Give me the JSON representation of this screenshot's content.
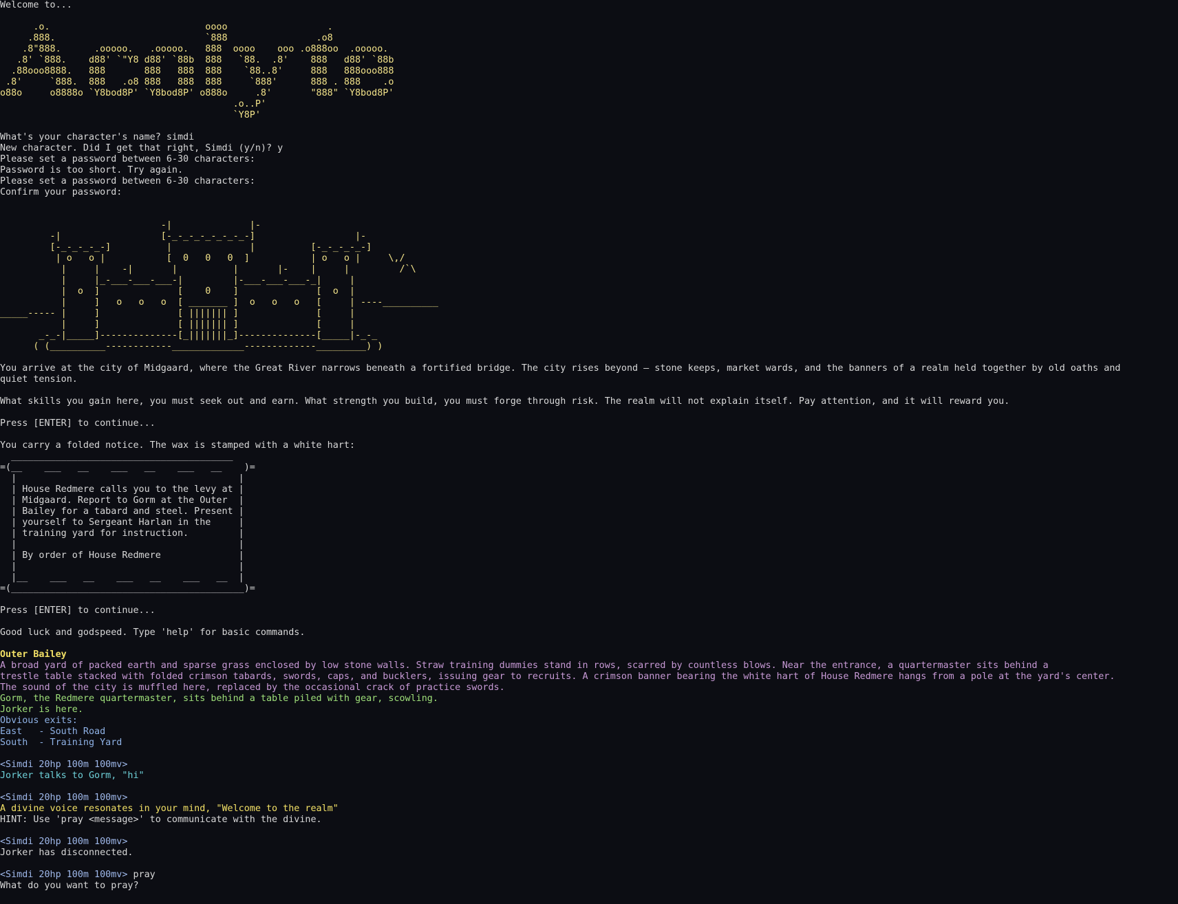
{
  "terminal": {
    "colors": {
      "background": "#0c0d13",
      "default": "#d8d8d8",
      "ascii": "#f2e289",
      "room": "#f2e066",
      "desc": "#c89ad6",
      "npc": "#9fe07a",
      "exits": "#8fb2e6",
      "prompt": "#9fb8ea",
      "talk": "#6ed0d8",
      "divine": "#f2e066"
    },
    "lines": [
      {
        "text": "Welcome to...",
        "kind": "default"
      },
      {
        "text": "",
        "kind": "default"
      },
      {
        "text": "      .o.                            oooo                  .",
        "kind": "ascii"
      },
      {
        "text": "     .888.                           `888                .o8",
        "kind": "ascii"
      },
      {
        "text": "    .8\"888.      .ooooo.   .ooooo.   888  oooo    ooo .o888oo  .ooooo.",
        "kind": "ascii"
      },
      {
        "text": "   .8' `888.    d88' `\"Y8 d88' `88b  888   `88.  .8'    888   d88' `88b",
        "kind": "ascii"
      },
      {
        "text": "  .88ooo8888.   888       888   888  888    `88..8'     888   888ooo888",
        "kind": "ascii"
      },
      {
        "text": " .8'     `888.  888   .o8 888   888  888     `888'      888 . 888    .o",
        "kind": "ascii"
      },
      {
        "text": "o88o     o8888o `Y8bod8P' `Y8bod8P' o888o     .8'       \"888\" `Y8bod8P'",
        "kind": "ascii"
      },
      {
        "text": "                                          .o..P'",
        "kind": "ascii"
      },
      {
        "text": "                                          `Y8P'",
        "kind": "ascii"
      },
      {
        "text": "",
        "kind": "default"
      },
      {
        "text": "What's your character's name? simdi",
        "kind": "default"
      },
      {
        "text": "New character. Did I get that right, Simdi (y/n)? y",
        "kind": "default"
      },
      {
        "text": "Please set a password between 6-30 characters:",
        "kind": "default"
      },
      {
        "text": "Password is too short. Try again.",
        "kind": "default"
      },
      {
        "text": "Please set a password between 6-30 characters:",
        "kind": "default"
      },
      {
        "text": "Confirm your password:",
        "kind": "default"
      },
      {
        "text": "",
        "kind": "default"
      },
      {
        "text": "",
        "kind": "default"
      },
      {
        "text": "                             -|              |-",
        "kind": "ascii"
      },
      {
        "text": "         -|                  [-_-_-_-_-_-_-_-]                  |-",
        "kind": "ascii"
      },
      {
        "text": "         [-_-_-_-_-]          |              |          [-_-_-_-_-]",
        "kind": "ascii"
      },
      {
        "text": "          | o   o |           [  0   0   0  ]           | o   o |     \\,/",
        "kind": "ascii"
      },
      {
        "text": "           |     |    -|       |          |       |-    |     |         /`\\",
        "kind": "ascii"
      },
      {
        "text": "           |     |_-___-___-___-|         |-___-___-___-_|     |",
        "kind": "ascii"
      },
      {
        "text": "           |  o  ]              [    0    ]              [  o  |",
        "kind": "ascii"
      },
      {
        "text": "           |     ]   o   o   o  [ _______ ]  o   o   o   [     | ----__________",
        "kind": "ascii"
      },
      {
        "text": "_____----- |     ]              [ ||||||| ]              [     |",
        "kind": "ascii"
      },
      {
        "text": "           |     ]              [ ||||||| ]              [     |",
        "kind": "ascii"
      },
      {
        "text": "       _-_-|_____]--------------[_|||||||_]--------------[_____|-_-_",
        "kind": "ascii"
      },
      {
        "text": "      ( (__________------------_____________-------------_________) )",
        "kind": "ascii"
      },
      {
        "text": "",
        "kind": "default"
      },
      {
        "text": "You arrive at the city of Midgaard, where the Great River narrows beneath a fortified bridge. The city rises beyond — stone keeps, market wards, and the banners of a realm held together by old oaths and",
        "kind": "default"
      },
      {
        "text": "quiet tension.",
        "kind": "default"
      },
      {
        "text": "",
        "kind": "default"
      },
      {
        "text": "What skills you gain here, you must seek out and earn. What strength you build, you must forge through risk. The realm will not explain itself. Pay attention, and it will reward you.",
        "kind": "default"
      },
      {
        "text": "",
        "kind": "default"
      },
      {
        "text": "Press [ENTER] to continue...",
        "kind": "default"
      },
      {
        "text": "",
        "kind": "default"
      },
      {
        "text": "You carry a folded notice. The wax is stamped with a white hart:",
        "kind": "default"
      },
      {
        "text": "  ________________________________________",
        "kind": "default"
      },
      {
        "text": "=(__    ___   __    ___   __    ___   __    )=",
        "kind": "default"
      },
      {
        "text": "  |                                        |",
        "kind": "default"
      },
      {
        "text": "  | House Redmere calls you to the levy at |",
        "kind": "default"
      },
      {
        "text": "  | Midgaard. Report to Gorm at the Outer  |",
        "kind": "default"
      },
      {
        "text": "  | Bailey for a tabard and steel. Present |",
        "kind": "default"
      },
      {
        "text": "  | yourself to Sergeant Harlan in the     |",
        "kind": "default"
      },
      {
        "text": "  | training yard for instruction.         |",
        "kind": "default"
      },
      {
        "text": "  |                                        |",
        "kind": "default"
      },
      {
        "text": "  | By order of House Redmere              |",
        "kind": "default"
      },
      {
        "text": "  |                                        |",
        "kind": "default"
      },
      {
        "text": "  |__    ___   __    ___   __    ___   __  |",
        "kind": "default"
      },
      {
        "text": "=(__________________________________________)=",
        "kind": "default"
      },
      {
        "text": "",
        "kind": "default"
      },
      {
        "text": "Press [ENTER] to continue...",
        "kind": "default"
      },
      {
        "text": "",
        "kind": "default"
      },
      {
        "text": "Good luck and godspeed. Type 'help' for basic commands.",
        "kind": "default"
      },
      {
        "text": "",
        "kind": "default"
      },
      {
        "text": "Outer Bailey",
        "kind": "room"
      },
      {
        "text": "A broad yard of packed earth and sparse grass enclosed by low stone walls. Straw training dummies stand in rows, scarred by countless blows. Near the entrance, a quartermaster sits behind a",
        "kind": "desc"
      },
      {
        "text": "trestle table stacked with folded crimson tabards, swords, caps, and bucklers, issuing gear to recruits. A crimson banner bearing the white hart of House Redmere hangs from a pole at the yard's center.",
        "kind": "desc"
      },
      {
        "text": "The sound of the city is muffled here, replaced by the occasional crack of practice swords.",
        "kind": "desc"
      },
      {
        "text": "Gorm, the Redmere quartermaster, sits behind a table piled with gear, scowling.",
        "kind": "npc"
      },
      {
        "text": "Jorker is here.",
        "kind": "npc"
      },
      {
        "text": "Obvious exits:",
        "kind": "exits"
      },
      {
        "text": "East   - South Road",
        "kind": "exits"
      },
      {
        "text": "South  - Training Yard",
        "kind": "exits"
      },
      {
        "text": "",
        "kind": "default"
      },
      {
        "text": "<Simdi 20hp 100m 100mv>",
        "kind": "prompt"
      },
      {
        "text": "Jorker talks to Gorm, \"hi\"",
        "kind": "talk"
      },
      {
        "text": "",
        "kind": "default"
      },
      {
        "text": "<Simdi 20hp 100m 100mv>",
        "kind": "prompt"
      },
      {
        "text": "A divine voice resonates in your mind, \"Welcome to the realm\"",
        "kind": "divine"
      },
      {
        "text": "HINT: Use 'pray <message>' to communicate with the divine.",
        "kind": "default"
      },
      {
        "text": "",
        "kind": "default"
      },
      {
        "text": "<Simdi 20hp 100m 100mv>",
        "kind": "prompt"
      },
      {
        "text": "Jorker has disconnected.",
        "kind": "default"
      },
      {
        "text": "",
        "kind": "default"
      },
      {
        "text": "<Simdi 20hp 100m 100mv>",
        "kind": "prompt",
        "suffix": " pray"
      },
      {
        "text": "What do you want to pray?",
        "kind": "default"
      }
    ]
  }
}
